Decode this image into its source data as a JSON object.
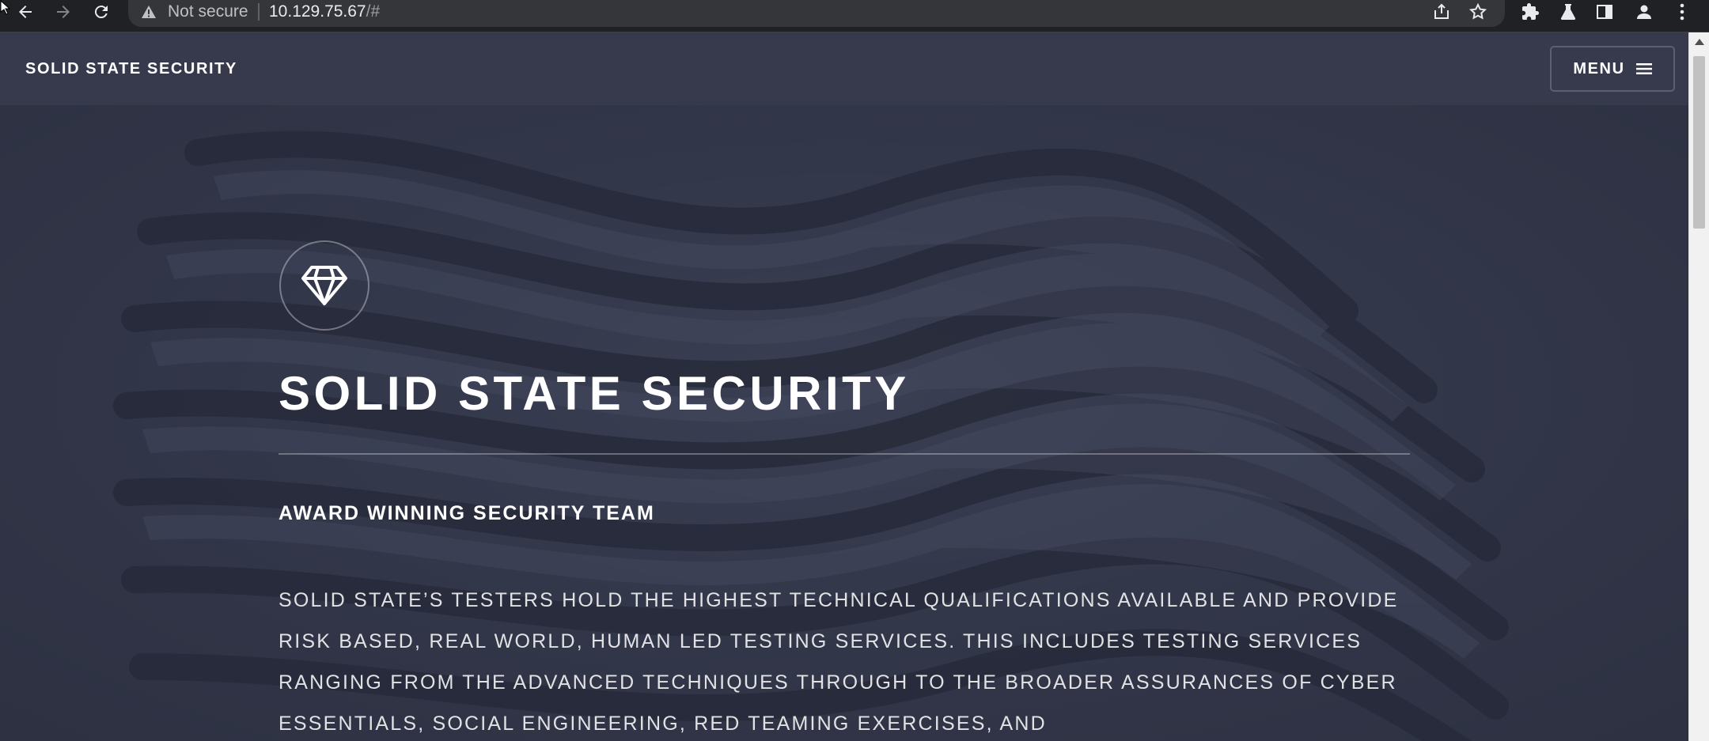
{
  "browser": {
    "security_label": "Not secure",
    "url_host": "10.129.75.67",
    "url_fragment": "/#"
  },
  "header": {
    "site_title": "SOLID STATE SECURITY",
    "menu_label": "MENU"
  },
  "hero": {
    "icon": "diamond-icon",
    "title": "SOLID STATE SECURITY",
    "subtitle": "AWARD WINNING SECURITY TEAM",
    "body": "Solid State’s testers hold the highest technical qualifications available and provide risk based, real world, human led testing services. This includes testing services ranging from the advanced techniques through to the broader assurances of Cyber Essentials, social engineering, red teaming exercises, and"
  },
  "colors": {
    "chrome_bg": "#202124",
    "header_bg": "#363a4c",
    "hero_overlay": "#2e3141",
    "text": "#ffffff"
  }
}
